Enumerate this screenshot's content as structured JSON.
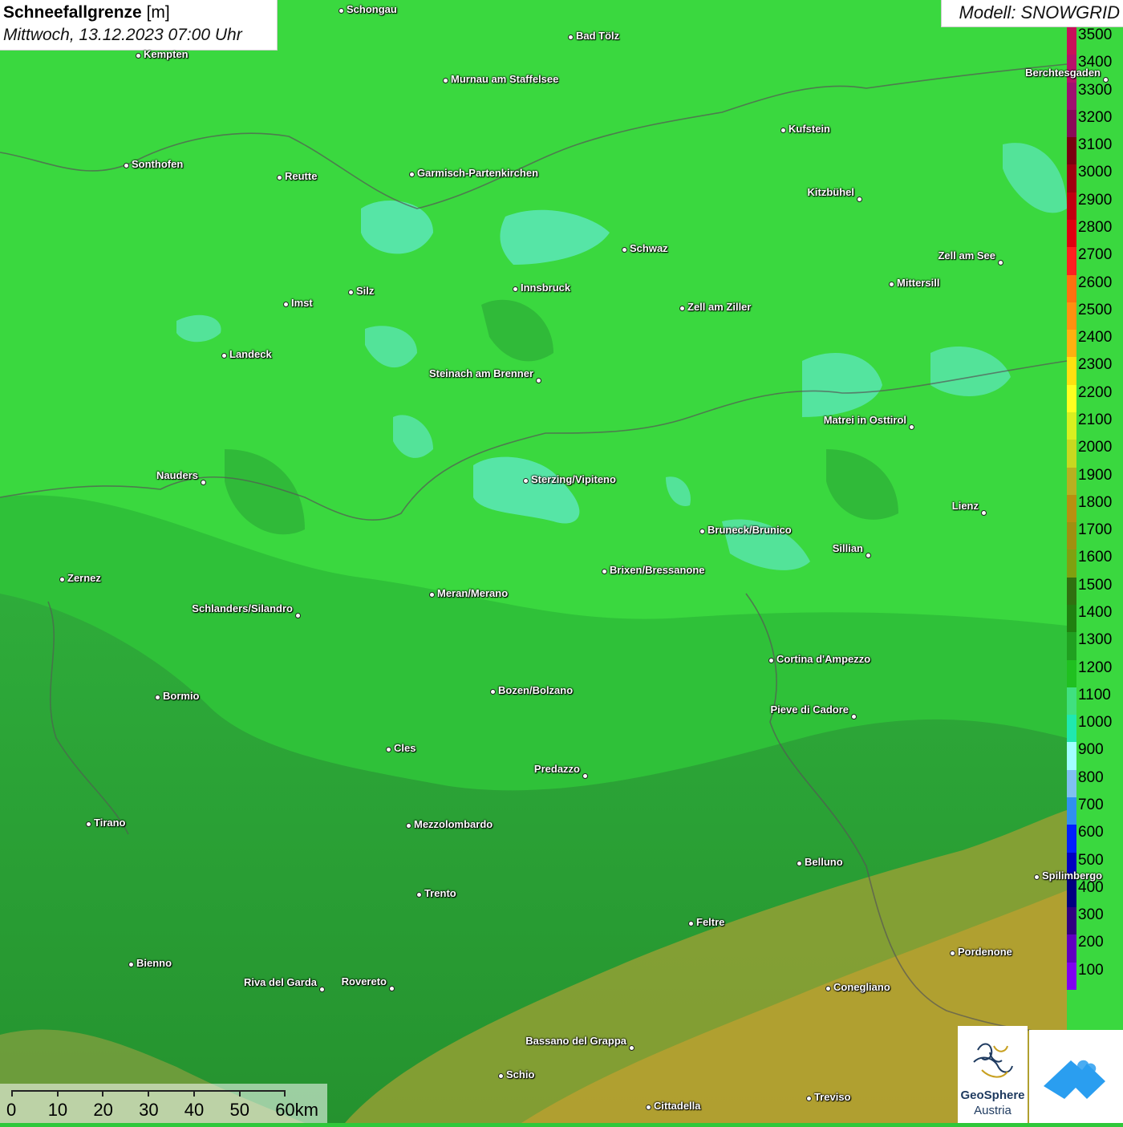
{
  "title": {
    "main_bold": "Schneefallgrenze",
    "unit": " [m]",
    "datetime": "Mittwoch, 13.12.2023 07:00 Uhr"
  },
  "model": "Modell: SNOWGRID",
  "legend": {
    "labels": [
      "3500",
      "3400",
      "3300",
      "3200",
      "3100",
      "3000",
      "2900",
      "2800",
      "2700",
      "2600",
      "2500",
      "2400",
      "2300",
      "2200",
      "2100",
      "2000",
      "1900",
      "1800",
      "1700",
      "1600",
      "1500",
      "1400",
      "1300",
      "1200",
      "1100",
      "1000",
      "900",
      "800",
      "700",
      "600",
      "500",
      "400",
      "300",
      "200",
      "100"
    ],
    "colors": [
      "#c8105a",
      "#b8106a",
      "#a01070",
      "#8a0a58",
      "#7a0010",
      "#a00010",
      "#c00010",
      "#e00010",
      "#ff2020",
      "#ff7010",
      "#ff9010",
      "#ffb010",
      "#ffe010",
      "#ffff20",
      "#d8f020",
      "#c8d820",
      "#b8b020",
      "#b89010",
      "#a09010",
      "#80a010",
      "#307010",
      "#208010",
      "#20a020",
      "#20c020",
      "#40e080",
      "#20e8b0",
      "#a0ffff",
      "#80c0f0",
      "#3090f0",
      "#0020ff",
      "#0000c0",
      "#000080",
      "#300080",
      "#6000c0",
      "#8000f0"
    ]
  },
  "cities": [
    {
      "name": "Schongau"
    },
    {
      "name": "Bad Tölz"
    },
    {
      "name": "Kempten"
    },
    {
      "name": "Murnau am Staffelsee"
    },
    {
      "name": "Berchtesgaden"
    },
    {
      "name": "Kufstein"
    },
    {
      "name": "Sonthofen"
    },
    {
      "name": "Reutte"
    },
    {
      "name": "Garmisch-Partenkirchen"
    },
    {
      "name": "Kitzbühel"
    },
    {
      "name": "Schwaz"
    },
    {
      "name": "Zell am See"
    },
    {
      "name": "Innsbruck"
    },
    {
      "name": "Mittersill"
    },
    {
      "name": "Imst"
    },
    {
      "name": "Silz"
    },
    {
      "name": "Zell am Ziller"
    },
    {
      "name": "Landeck"
    },
    {
      "name": "Steinach am Brenner"
    },
    {
      "name": "Matrei in Osttirol"
    },
    {
      "name": "Nauders"
    },
    {
      "name": "Sterzing/Vipiteno"
    },
    {
      "name": "Lienz"
    },
    {
      "name": "Bruneck/Brunico"
    },
    {
      "name": "Sillian"
    },
    {
      "name": "Zernez"
    },
    {
      "name": "Brixen/Bressanone"
    },
    {
      "name": "Meran/Merano"
    },
    {
      "name": "Schlanders/Silandro"
    },
    {
      "name": "Cortina d'Ampezzo"
    },
    {
      "name": "Bormio"
    },
    {
      "name": "Bozen/Bolzano"
    },
    {
      "name": "Pieve di Cadore"
    },
    {
      "name": "Cles"
    },
    {
      "name": "Predazzo"
    },
    {
      "name": "Tirano"
    },
    {
      "name": "Mezzolombardo"
    },
    {
      "name": "Belluno"
    },
    {
      "name": "Spilimbergo"
    },
    {
      "name": "Trento"
    },
    {
      "name": "Feltre"
    },
    {
      "name": "Pordenone"
    },
    {
      "name": "Bienno"
    },
    {
      "name": "Riva del Garda"
    },
    {
      "name": "Rovereto"
    },
    {
      "name": "Conegliano"
    },
    {
      "name": "Bassano del Grappa"
    },
    {
      "name": "Schio"
    },
    {
      "name": "Treviso"
    },
    {
      "name": "Cittadella"
    }
  ],
  "scale": {
    "labels": [
      "0",
      "10",
      "20",
      "30",
      "40",
      "50",
      "60km"
    ]
  },
  "logo": {
    "line1": "GeoSphere",
    "line2": "Austria"
  },
  "colors": {
    "green_high": "#3fe03f",
    "green_mid": "#2fc83a",
    "green_dark": "#248f2c",
    "cyan": "#5ef0c0",
    "olive": "#b8a030"
  }
}
